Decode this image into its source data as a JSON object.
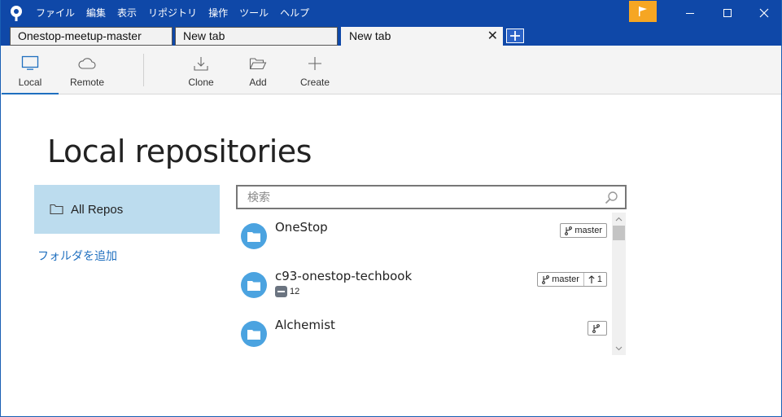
{
  "menu": [
    "ファイル",
    "編集",
    "表示",
    "リポジトリ",
    "操作",
    "ツール",
    "ヘルプ"
  ],
  "tabs": [
    {
      "label": "Onestop-meetup-master",
      "active": false
    },
    {
      "label": "New tab",
      "active": false
    },
    {
      "label": "New tab",
      "active": true
    }
  ],
  "tab_close": "✕",
  "toolbar": {
    "local": "Local",
    "remote": "Remote",
    "clone": "Clone",
    "add": "Add",
    "create": "Create"
  },
  "page_title": "Local repositories",
  "sidebar": {
    "all_repos": "All Repos",
    "add_folder": "フォルダを追加"
  },
  "search": {
    "placeholder": "検索"
  },
  "repos": [
    {
      "name": "OneStop",
      "branch": "master",
      "ahead": "",
      "stash": ""
    },
    {
      "name": "c93-onestop-techbook",
      "branch": "master",
      "ahead": "1",
      "stash": "12"
    },
    {
      "name": "Alchemist",
      "branch": "",
      "ahead": "",
      "stash": ""
    }
  ],
  "colors": {
    "titlebar": "#0f48a8",
    "accent": "#1f6fbf",
    "flag": "#f6a623",
    "repo_icon": "#4ba3e0",
    "sidebar_selected": "#bcdcee"
  },
  "icons": {
    "app": "sourcetree-logo-icon",
    "flag": "flag-icon",
    "minimize": "minimize-icon",
    "maximize": "maximize-icon",
    "close": "close-icon",
    "new_tab": "plus-icon",
    "local": "monitor-icon",
    "remote": "cloud-icon",
    "clone": "download-icon",
    "add": "open-folder-icon",
    "create": "plus-icon",
    "folder": "folder-icon",
    "search": "search-icon",
    "branch": "branch-icon",
    "arrow_up": "arrow-up-icon"
  }
}
